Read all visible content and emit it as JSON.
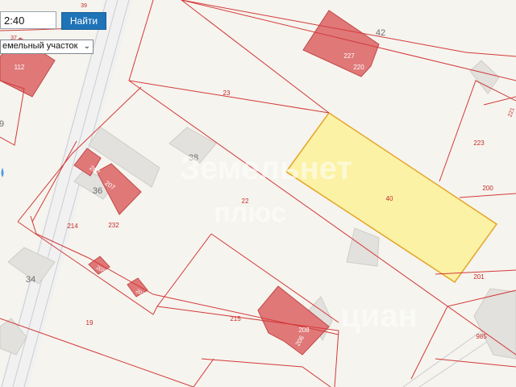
{
  "search": {
    "value": "2:40"
  },
  "find_button": {
    "label": "Найти"
  },
  "layer_select": {
    "value": "емельный участок"
  },
  "watermark": {
    "line1": "Земельнет",
    "line2": "плюс",
    "line3": "циан"
  },
  "colors": {
    "parcel_line": "#d23a3a",
    "building_fill": "#e07878",
    "highlight_fill": "#fbf2a5",
    "highlight_stroke": "#e6a52a",
    "road": "#c9cdd2"
  },
  "parcels": {
    "p23": "23",
    "p22": "22",
    "p19": "19",
    "p214": "214",
    "p215": "215",
    "p223": "223",
    "p200": "200",
    "p201": "201",
    "p985": "985",
    "p40": "40"
  },
  "houses": {
    "h42": "42",
    "h38": "38",
    "h36": "36",
    "h34": "34",
    "h9": "9"
  },
  "buildings": {
    "b227": "227",
    "b220": "220",
    "b112": "112",
    "b207a": "207",
    "b207b": "207",
    "b232": "232",
    "b205": "205",
    "b202": "202",
    "b208": "208",
    "b206": "206",
    "b37": "37",
    "b39": "39",
    "b221": "221"
  }
}
